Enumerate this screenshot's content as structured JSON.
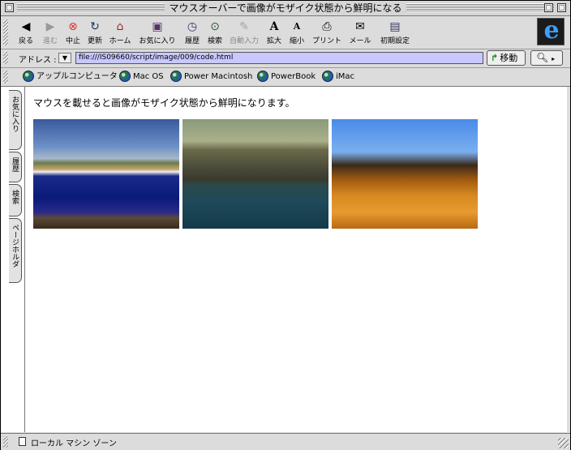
{
  "window": {
    "title": "マウスオーバーで画像がモザイク状態から鮮明になる"
  },
  "toolbar": {
    "buttons": [
      {
        "label": "戻る",
        "icon": "back-arrow-icon"
      },
      {
        "label": "進む",
        "icon": "forward-arrow-icon"
      },
      {
        "label": "中止",
        "icon": "stop-icon"
      },
      {
        "label": "更新",
        "icon": "refresh-icon"
      },
      {
        "label": "ホーム",
        "icon": "home-icon"
      },
      {
        "label": "お気に入り",
        "icon": "favorites-icon"
      },
      {
        "label": "履歴",
        "icon": "history-icon"
      },
      {
        "label": "検索",
        "icon": "search-icon"
      },
      {
        "label": "自動入力",
        "icon": "autofill-icon"
      },
      {
        "label": "拡大",
        "icon": "text-larger-icon"
      },
      {
        "label": "縮小",
        "icon": "text-smaller-icon"
      },
      {
        "label": "プリント",
        "icon": "print-icon"
      },
      {
        "label": "メール",
        "icon": "mail-icon"
      },
      {
        "label": "初期設定",
        "icon": "preferences-icon"
      }
    ],
    "logo_icon": "ie-logo-icon"
  },
  "address": {
    "label": "アドレス :",
    "url": "file:///IS09660/script/image/009/code.html",
    "go_label": "移動"
  },
  "favorites": [
    {
      "label": "アップルコンピュータ"
    },
    {
      "label": "Mac OS"
    },
    {
      "label": "Power Macintosh"
    },
    {
      "label": "PowerBook"
    },
    {
      "label": "iMac"
    }
  ],
  "side_tabs": [
    {
      "label": "お気に入り"
    },
    {
      "label": "履歴"
    },
    {
      "label": "検索"
    },
    {
      "label": "ページホルダ"
    }
  ],
  "content": {
    "message": "マウスを載せると画像がモザイク状態から鮮明になります。",
    "images": [
      "beach-landscape-image",
      "mountain-lake-image",
      "desert-peak-image"
    ]
  },
  "status": {
    "zone": "ローカル マシン ゾーン"
  }
}
